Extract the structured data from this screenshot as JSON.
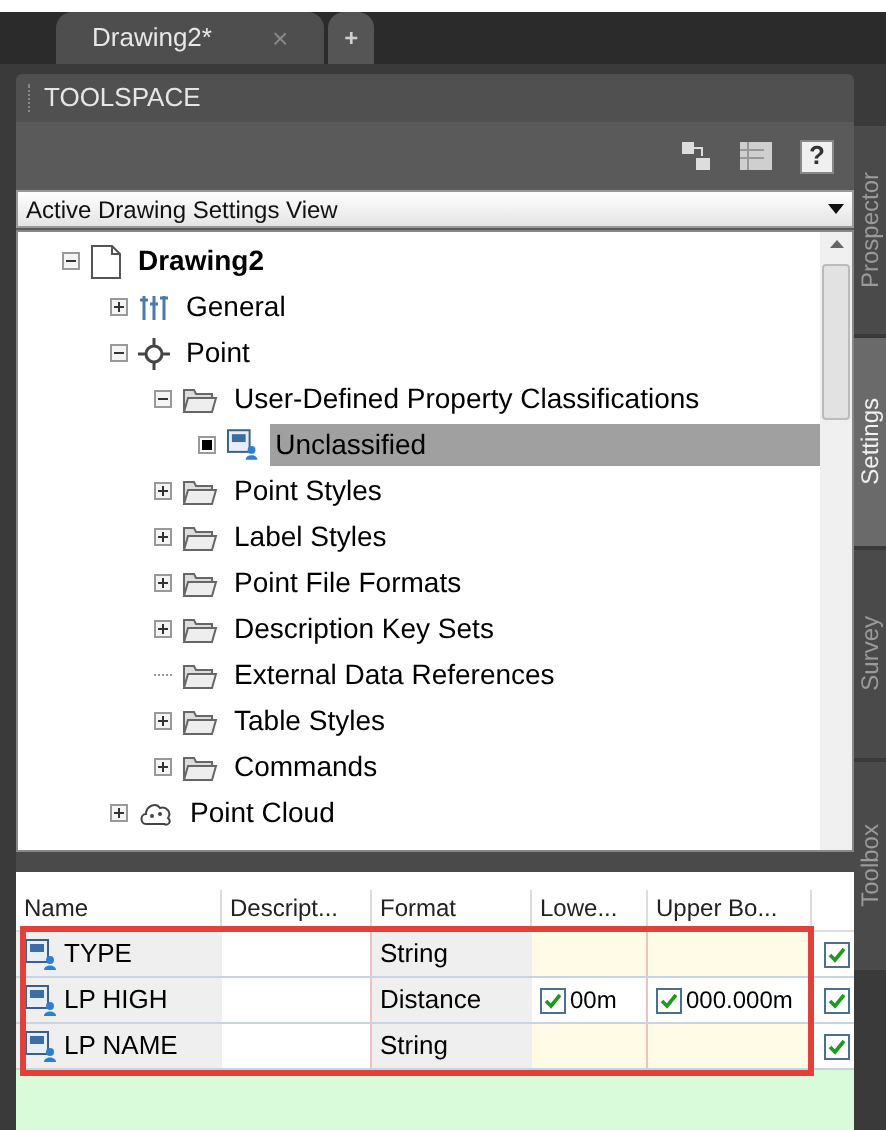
{
  "document_tabs": [
    {
      "label": "Drawing2*",
      "selected": true,
      "close": "×"
    },
    {
      "label": "+",
      "selected": false
    }
  ],
  "panel": {
    "title": "TOOLSPACE",
    "help": "?"
  },
  "view_dropdown": {
    "value": "Active Drawing Settings View"
  },
  "tree": [
    {
      "label": "Drawing2",
      "kind": "drawing",
      "expanded": true,
      "selected": false,
      "children": [
        {
          "label": "General",
          "kind": "general",
          "expanded": false,
          "selected": false
        },
        {
          "label": "Point",
          "kind": "point",
          "expanded": true,
          "selected": false,
          "children": [
            {
              "label": "User-Defined Property Classifications",
              "kind": "folder",
              "expanded": true,
              "selected": false,
              "children": [
                {
                  "label": "Unclassified",
                  "kind": "classification",
                  "selected": true
                }
              ]
            },
            {
              "label": "Point Styles",
              "kind": "folder",
              "expanded": false,
              "selected": false
            },
            {
              "label": "Label Styles",
              "kind": "folder",
              "expanded": false,
              "selected": false
            },
            {
              "label": "Point File Formats",
              "kind": "folder",
              "expanded": false,
              "selected": false
            },
            {
              "label": "Description Key Sets",
              "kind": "folder",
              "expanded": false,
              "selected": false
            },
            {
              "label": "External Data References",
              "kind": "folder",
              "selected": false
            },
            {
              "label": "Table Styles",
              "kind": "folder",
              "expanded": false,
              "selected": false
            },
            {
              "label": "Commands",
              "kind": "folder",
              "expanded": false,
              "selected": false
            }
          ]
        },
        {
          "label": "Point Cloud",
          "kind": "cloud",
          "expanded": false,
          "selected": false
        }
      ]
    }
  ],
  "side_tabs": [
    {
      "label": "Prospector",
      "selected": false
    },
    {
      "label": "Settings",
      "selected": true
    },
    {
      "label": "Survey",
      "selected": false
    },
    {
      "label": "Toolbox",
      "selected": false
    }
  ],
  "table": {
    "columns": [
      "Name",
      "Descript...",
      "Format",
      "Lowe...",
      "Upper Bo..."
    ],
    "rows": [
      {
        "name": "TYPE",
        "format": "String",
        "column_6": {
          "checked": true
        }
      },
      {
        "name": "LP HIGH",
        "format": "Distance",
        "lower": {
          "checked": true,
          "value": "00m"
        },
        "upper": {
          "checked": true,
          "value": "000.000m"
        },
        "column_6": {
          "checked": true
        }
      },
      {
        "name": "LP NAME",
        "format": "String",
        "column_6": {
          "checked": true
        }
      }
    ]
  }
}
